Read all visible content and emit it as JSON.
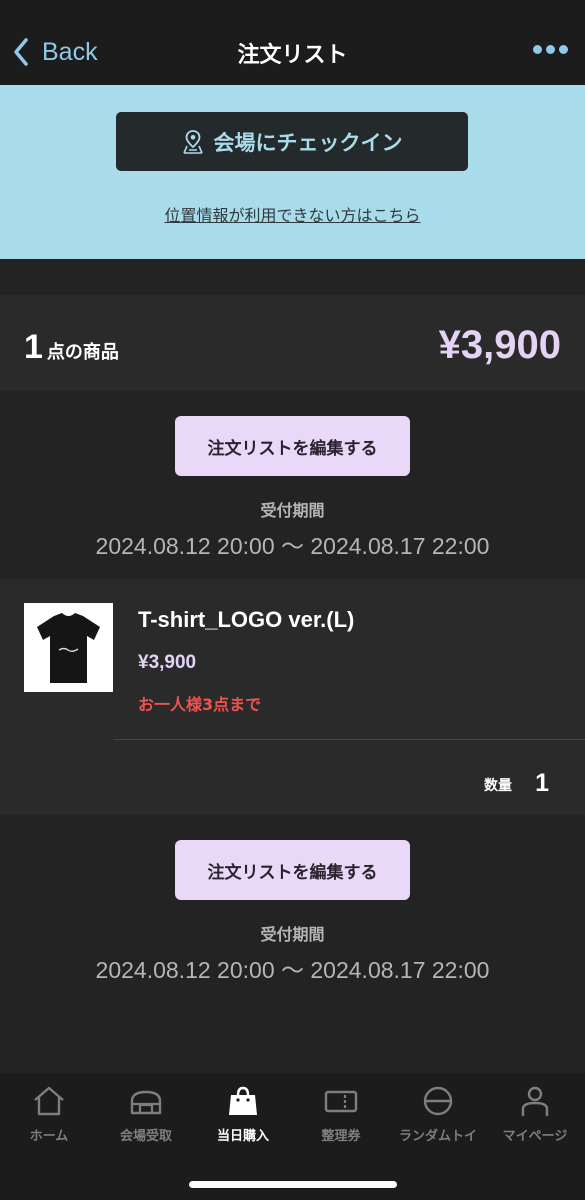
{
  "header": {
    "back_label": "Back",
    "title": "注文リスト",
    "back_icon": "chevron-left-icon",
    "more_icon": "more-icon",
    "accent": "#8ec9e8"
  },
  "checkin": {
    "button_label": "会場にチェックイン",
    "icon": "map-pin-icon",
    "link_text": "位置情報が利用できない方はこちら",
    "background": "#a9dcea"
  },
  "summary": {
    "count": "1",
    "count_unit": "点の商品",
    "total": "¥3,900"
  },
  "edit_button_label": "注文リストを編集する",
  "period": {
    "label": "受付期間",
    "value": "2024.08.12 20:00 ～ 2024.08.17 22:00"
  },
  "item": {
    "name": "T-shirt_LOGO ver.(L)",
    "price": "¥3,900",
    "limit_note": "お一人様3点まで",
    "quantity_label": "数量",
    "quantity": "1",
    "thumbnail_icon": "tshirt-image"
  },
  "tabbar": {
    "items": [
      {
        "label": "ホーム",
        "icon": "home-icon",
        "active": false
      },
      {
        "label": "会場受取",
        "icon": "pickup-icon",
        "active": false
      },
      {
        "label": "当日購入",
        "icon": "shopping-bag-icon",
        "active": true
      },
      {
        "label": "整理券",
        "icon": "ticket-icon",
        "active": false
      },
      {
        "label": "ランダムトイ",
        "icon": "random-toy-icon",
        "active": false
      },
      {
        "label": "マイページ",
        "icon": "user-icon",
        "active": false
      }
    ]
  },
  "colors": {
    "price": "#e4d3f5",
    "edit_button": "#e9d8f7",
    "limit_note": "#f05151"
  }
}
